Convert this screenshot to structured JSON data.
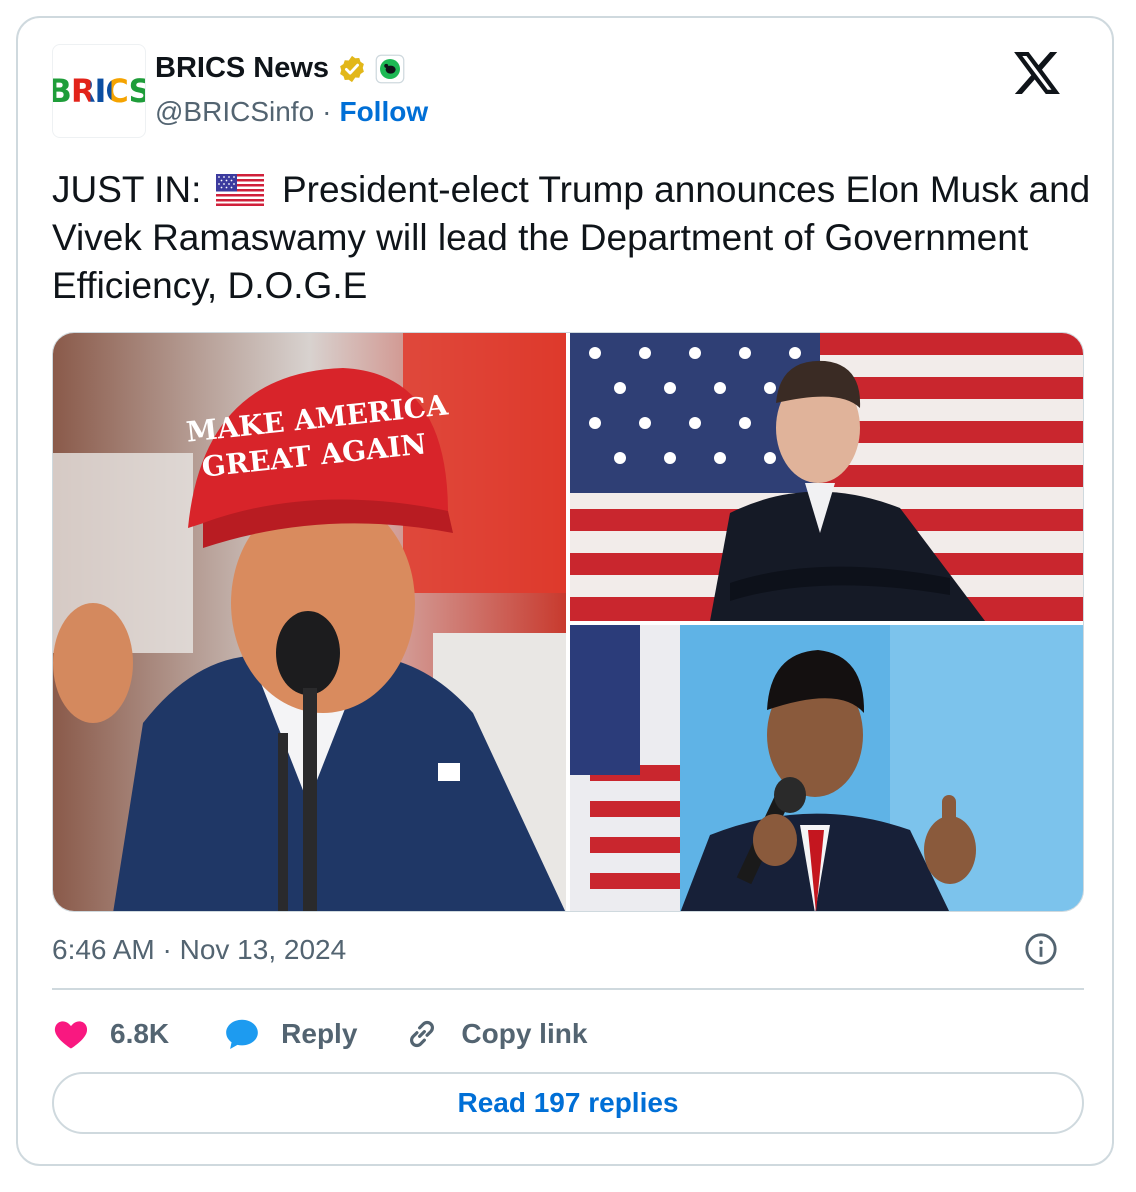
{
  "author": {
    "avatar_text": "BRICS",
    "name": "BRICS News",
    "handle": "@BRICSinfo",
    "separator": "·",
    "follow_label": "Follow"
  },
  "tweet": {
    "text_prefix": "JUST IN:",
    "text_body": "President-elect Trump announces Elon Musk and Vivek Ramaswamy will lead the Department of Government Efficiency, D.O.G.E",
    "timestamp": "6:46 AM · Nov 13, 2024"
  },
  "media": {
    "cap_line1": "MAKE AMERICA",
    "cap_line2": "GREAT AGAIN"
  },
  "actions": {
    "like_count": "6.8K",
    "reply_label": "Reply",
    "copy_label": "Copy link"
  },
  "footer": {
    "read_replies_label": "Read 197 replies"
  },
  "colors": {
    "like": "#f91880",
    "reply": "#1d9bf0",
    "link": "#006fd6",
    "muted": "#536471",
    "verified": "#e2b719"
  },
  "icons": [
    "x-logo-icon",
    "verified-badge-icon",
    "affiliate-badge-icon",
    "us-flag-icon",
    "info-icon",
    "heart-icon",
    "reply-bubble-icon",
    "link-icon"
  ]
}
